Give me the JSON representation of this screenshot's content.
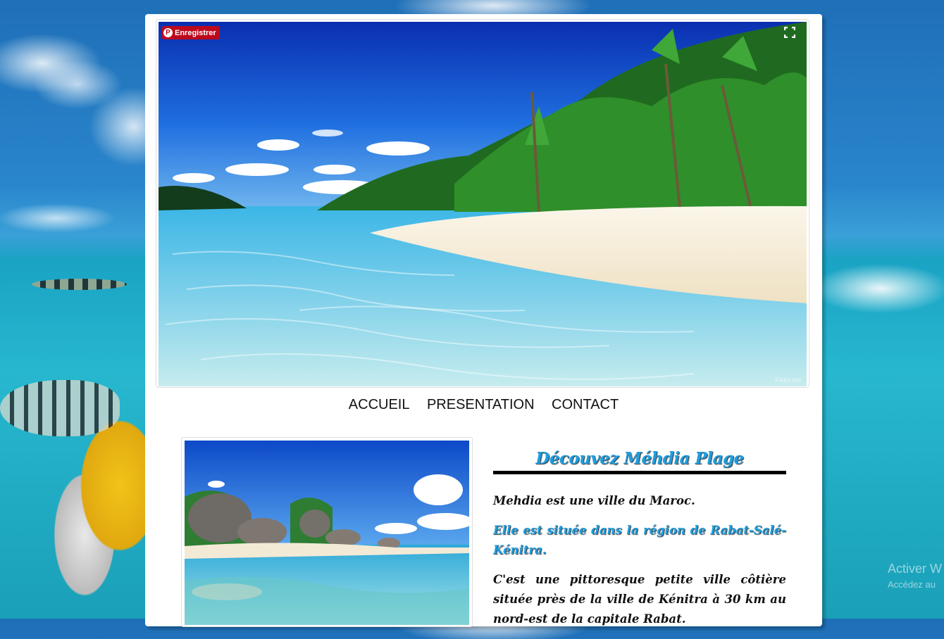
{
  "hero": {
    "pin_label": "Enregistrer",
    "pin_icon": "pinterest-icon",
    "fullscreen_icon": "fullscreen-icon",
    "watermark": "Fiskó.net"
  },
  "nav": [
    {
      "label": "ACCUEIL"
    },
    {
      "label": "PRESENTATION"
    },
    {
      "label": "CONTACT"
    }
  ],
  "content": {
    "title": "Découvez Méhdia Plage",
    "p1": "Mehdia est une ville du Maroc.",
    "p2": "Elle est située dans la région de Rabat-Salé-Kénitra.",
    "p3": "C'est une pittoresque petite ville côtière située près de la ville de Kénitra à 30 km au nord-est de la capitale Rabat."
  },
  "watermark_os": {
    "line1": "Activer W",
    "line2": "Accédez au"
  },
  "colors": {
    "accent": "#1e9ee0",
    "pinterest": "#bd081c"
  }
}
